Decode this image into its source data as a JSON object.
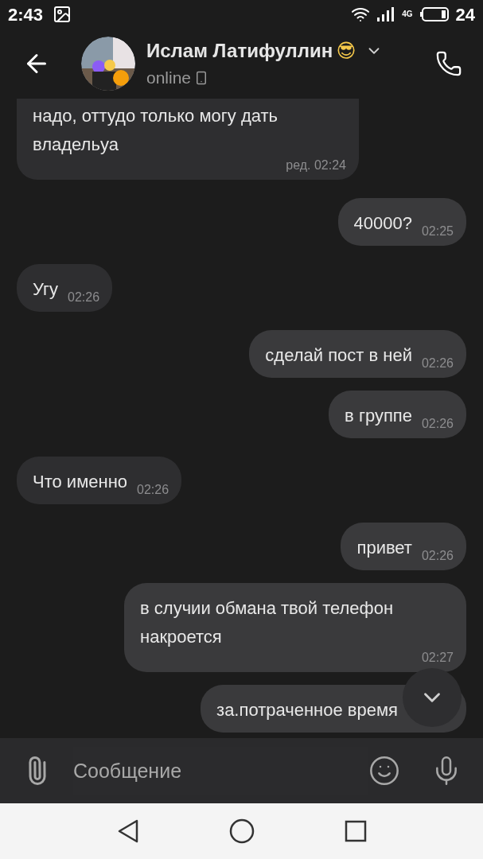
{
  "status_bar": {
    "time": "2:43",
    "network": "4G",
    "battery": "24"
  },
  "header": {
    "name": "Ислам Латифуллин",
    "emoji": "😎",
    "status": "online"
  },
  "messages": [
    {
      "text": "надо, оттудо только могу дать владельуа",
      "time": "ред. 02:24",
      "outgoing": false,
      "multiline": true
    },
    {
      "text": "40000?",
      "time": "02:25",
      "outgoing": true,
      "multiline": false
    },
    {
      "text": "Угу",
      "time": "02:26",
      "outgoing": false,
      "multiline": false
    },
    {
      "text": "сделай пост в ней",
      "time": "02:26",
      "outgoing": true,
      "multiline": false
    },
    {
      "text": "в группе",
      "time": "02:26",
      "outgoing": true,
      "multiline": false
    },
    {
      "text": "Что именно",
      "time": "02:26",
      "outgoing": false,
      "multiline": false
    },
    {
      "text": "привет",
      "time": "02:26",
      "outgoing": true,
      "multiline": false
    },
    {
      "text": "в случии обмана твой телефон накроется",
      "time": "02:27",
      "outgoing": true,
      "multiline": true
    },
    {
      "text": "за.потраченное время",
      "outgoing": true,
      "multiline": false
    }
  ],
  "composer": {
    "placeholder": "Сообщение"
  }
}
